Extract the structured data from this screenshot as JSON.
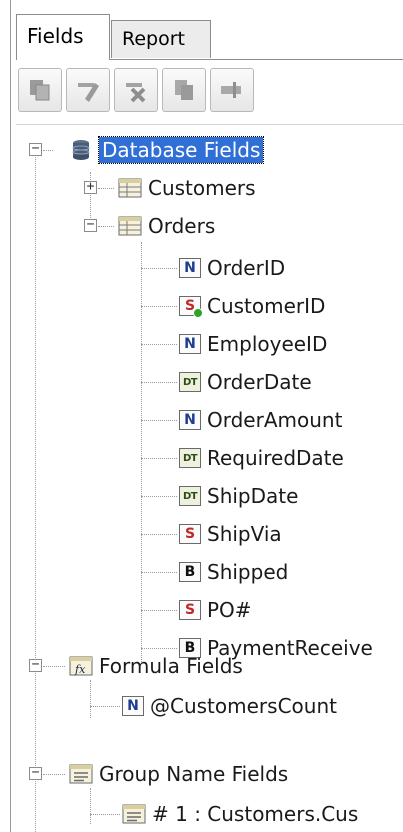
{
  "tabs": [
    {
      "label": "Fields",
      "active": true
    },
    {
      "label": "Report",
      "active": false
    }
  ],
  "toolbar": {
    "buttons": [
      {
        "icon": "copy-icon"
      },
      {
        "icon": "edit-icon"
      },
      {
        "icon": "delete-icon"
      },
      {
        "icon": "duplicate-icon"
      },
      {
        "icon": "rename-icon"
      }
    ]
  },
  "tree": {
    "database": {
      "label": "Database Fields",
      "icon": "database-icon",
      "expanded": true
    },
    "customers": {
      "label": "Customers",
      "icon": "table-icon",
      "expanded": false
    },
    "orders": {
      "label": "Orders",
      "icon": "table-icon",
      "expanded": true
    },
    "order_fields": [
      {
        "type": "N",
        "label": "OrderID"
      },
      {
        "type": "S",
        "label": "CustomerID",
        "checked": true
      },
      {
        "type": "N",
        "label": "EmployeeID"
      },
      {
        "type": "DT",
        "label": "OrderDate"
      },
      {
        "type": "N",
        "label": "OrderAmount"
      },
      {
        "type": "DT",
        "label": "RequiredDate"
      },
      {
        "type": "DT",
        "label": "ShipDate"
      },
      {
        "type": "S",
        "label": "ShipVia"
      },
      {
        "type": "B",
        "label": "Shipped"
      },
      {
        "type": "S",
        "label": "PO#"
      },
      {
        "type": "B",
        "label": "PaymentReceive"
      }
    ],
    "formula": {
      "label": "Formula Fields",
      "icon": "formula-icon",
      "expanded": true
    },
    "formula_fields": [
      {
        "type": "N",
        "label": "@CustomersCount"
      }
    ],
    "group_name": {
      "label": "Group Name Fields",
      "icon": "group-icon",
      "expanded": true
    },
    "group_fields": [
      {
        "icon": "group-icon",
        "label": "# 1 : Customers.Cus"
      }
    ]
  },
  "colors": {
    "selection": "#2f6fd6",
    "number_badge": "#1f3c91",
    "string_badge": "#c02828"
  }
}
